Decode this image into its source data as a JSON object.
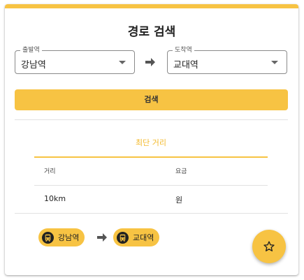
{
  "colors": {
    "accent": "#f7c343",
    "tab_active_text": "#f3b92a"
  },
  "title": "경로 검색",
  "from_select": {
    "label": "출발역",
    "value": "강남역"
  },
  "to_select": {
    "label": "도착역",
    "value": "교대역"
  },
  "search_button": {
    "label": "검색"
  },
  "tabs": [
    {
      "label": "최단 거리",
      "active": true
    }
  ],
  "result_table": {
    "headers": [
      "거리",
      "요금"
    ],
    "rows": [
      [
        "10km",
        "원"
      ]
    ]
  },
  "route": {
    "stations": [
      {
        "label": "강남역",
        "icon": "bus-icon"
      },
      {
        "label": "교대역",
        "icon": "bus-icon"
      }
    ]
  },
  "fab": {
    "icon": "star-icon"
  }
}
